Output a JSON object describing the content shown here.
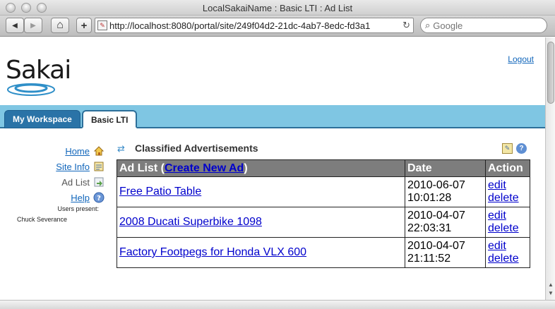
{
  "window": {
    "title": "LocalSakaiName : Basic LTI : Ad List"
  },
  "browser": {
    "url": "http://localhost:8080/portal/site/249f04d2-21dc-4ab7-8edc-fd3a1",
    "search_placeholder": "Google",
    "back_icon": "◀",
    "forward_icon": "▶",
    "home_icon": "⌂",
    "add_icon": "+",
    "reload_icon": "↻",
    "search_icon": "⌕"
  },
  "header": {
    "logo_text": "Sakai",
    "logout": "Logout"
  },
  "tabs": [
    {
      "label": "My Workspace",
      "active": false
    },
    {
      "label": "Basic LTI",
      "active": true
    }
  ],
  "nav": {
    "items": [
      {
        "label": "Home",
        "icon": "home-icon",
        "current": false
      },
      {
        "label": "Site Info",
        "icon": "site-info-icon",
        "current": false
      },
      {
        "label": "Ad List",
        "icon": "tool-icon",
        "current": true
      },
      {
        "label": "Help",
        "icon": "help-icon",
        "current": false
      }
    ],
    "presence_label": "Users present:",
    "presence_user": "Chuck Severance"
  },
  "tool": {
    "title": "Classified Advertisements",
    "table": {
      "header_prefix": "Ad List (",
      "header_link": "Create New Ad",
      "header_suffix": ")",
      "date_header": "Date",
      "action_header": "Action",
      "rows": [
        {
          "title": "Free Patio Table",
          "date": "2010-06-07",
          "time": "10:01:28",
          "edit": "edit",
          "delete": "delete"
        },
        {
          "title": "2008 Ducati Superbike 1098",
          "date": "2010-04-07",
          "time": "22:03:31",
          "edit": "edit",
          "delete": "delete"
        },
        {
          "title": "Factory Footpegs for Honda VLX 600",
          "date": "2010-04-07",
          "time": "21:11:52",
          "edit": "edit",
          "delete": "delete"
        }
      ]
    }
  },
  "colors": {
    "tab_bar": "#7fc6e3",
    "tab_inactive": "#2a73a7",
    "table_header": "#7d7d7d",
    "link": "#0000cc"
  }
}
